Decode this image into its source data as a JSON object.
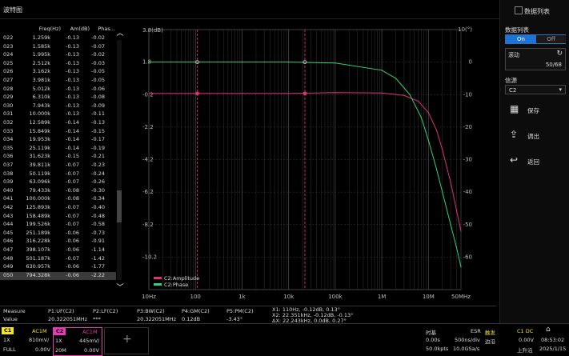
{
  "title": "波特图",
  "table": {
    "headers": {
      "freq": "Freq(Hz)",
      "amp": "Am(dB)",
      "phase": "Phas..."
    },
    "rows": [
      {
        "idx": "022",
        "freq": "1.259k",
        "amp": "-0.13",
        "phase": "-0.02"
      },
      {
        "idx": "023",
        "freq": "1.585k",
        "amp": "-0.13",
        "phase": "-0.07"
      },
      {
        "idx": "024",
        "freq": "1.995k",
        "amp": "-0.13",
        "phase": "-0.02"
      },
      {
        "idx": "025",
        "freq": "2.512k",
        "amp": "-0.13",
        "phase": "-0.03"
      },
      {
        "idx": "026",
        "freq": "3.162k",
        "amp": "-0.13",
        "phase": "-0.05"
      },
      {
        "idx": "027",
        "freq": "3.981k",
        "amp": "-0.13",
        "phase": "-0.05"
      },
      {
        "idx": "028",
        "freq": "5.012k",
        "amp": "-0.13",
        "phase": "-0.06"
      },
      {
        "idx": "029",
        "freq": "6.310k",
        "amp": "-0.13",
        "phase": "-0.08"
      },
      {
        "idx": "030",
        "freq": "7.943k",
        "amp": "-0.13",
        "phase": "-0.09"
      },
      {
        "idx": "031",
        "freq": "10.000k",
        "amp": "-0.13",
        "phase": "-0.11"
      },
      {
        "idx": "032",
        "freq": "12.589k",
        "amp": "-0.14",
        "phase": "-0.13"
      },
      {
        "idx": "033",
        "freq": "15.849k",
        "amp": "-0.14",
        "phase": "-0.15"
      },
      {
        "idx": "034",
        "freq": "19.953k",
        "amp": "-0.14",
        "phase": "-0.17"
      },
      {
        "idx": "035",
        "freq": "25.119k",
        "amp": "-0.14",
        "phase": "-0.19"
      },
      {
        "idx": "036",
        "freq": "31.623k",
        "amp": "-0.15",
        "phase": "-0.21"
      },
      {
        "idx": "037",
        "freq": "39.811k",
        "amp": "-0.07",
        "phase": "-0.23"
      },
      {
        "idx": "038",
        "freq": "50.119k",
        "amp": "-0.07",
        "phase": "-0.24"
      },
      {
        "idx": "039",
        "freq": "63.096k",
        "amp": "-0.07",
        "phase": "-0.26"
      },
      {
        "idx": "040",
        "freq": "79.433k",
        "amp": "-0.08",
        "phase": "-0.30"
      },
      {
        "idx": "041",
        "freq": "100.000k",
        "amp": "-0.08",
        "phase": "-0.34"
      },
      {
        "idx": "042",
        "freq": "125.893k",
        "amp": "-0.07",
        "phase": "-0.40"
      },
      {
        "idx": "043",
        "freq": "158.489k",
        "amp": "-0.07",
        "phase": "-0.48"
      },
      {
        "idx": "044",
        "freq": "199.526k",
        "amp": "-0.07",
        "phase": "-0.58"
      },
      {
        "idx": "045",
        "freq": "251.189k",
        "amp": "-0.06",
        "phase": "-0.73"
      },
      {
        "idx": "046",
        "freq": "316.228k",
        "amp": "-0.06",
        "phase": "-0.91"
      },
      {
        "idx": "047",
        "freq": "398.107k",
        "amp": "-0.06",
        "phase": "-1.14"
      },
      {
        "idx": "048",
        "freq": "501.187k",
        "amp": "-0.07",
        "phase": "-1.42"
      },
      {
        "idx": "049",
        "freq": "630.957k",
        "amp": "-0.06",
        "phase": "-1.77"
      },
      {
        "idx": "050",
        "freq": "794.328k",
        "amp": "-0.06",
        "phase": "-2.22"
      }
    ]
  },
  "chart_data": {
    "type": "line",
    "xscale": "log",
    "xlim": [
      10,
      50000000
    ],
    "x_ticks": [
      "10Hz",
      "100",
      "1k",
      "10k",
      "100k",
      "1M",
      "10M",
      "50MHz"
    ],
    "y_left_ticks": [
      "3.8(dB)",
      "1.8",
      "-0.2",
      "-2.2",
      "-4.2",
      "-6.2",
      "-8.2",
      "-10.2"
    ],
    "y_right_ticks": [
      "10(°)",
      "0",
      "-10",
      "-20",
      "-30",
      "-40",
      "-50",
      "-60"
    ],
    "ylim_left": [
      -12.2,
      3.8
    ],
    "ylim_right": [
      -70,
      10
    ],
    "series": [
      {
        "name": "C2:Amplitude",
        "color": "#e0307a",
        "x": [
          10,
          100,
          1000,
          10000,
          100000,
          1000000,
          3000000,
          6000000,
          10000000,
          15000000,
          20000000,
          30000000,
          40000000,
          50000000
        ],
        "y": [
          -0.13,
          -0.13,
          -0.13,
          -0.13,
          -0.08,
          -0.1,
          -0.25,
          -0.6,
          -1.3,
          -2.4,
          -3.6,
          -5.6,
          -7.3,
          -8.6
        ]
      },
      {
        "name": "C2:Phase",
        "color": "#2fd17a",
        "x": [
          10,
          100,
          1000,
          10000,
          100000,
          1000000,
          2000000,
          4000000,
          7000000,
          10000000,
          15000000,
          20000000,
          30000000,
          40000000,
          50000000
        ],
        "y": [
          0,
          0,
          0,
          0,
          -0.3,
          -2.5,
          -5,
          -10,
          -17,
          -24,
          -33,
          -40,
          -50,
          -57,
          -63
        ]
      }
    ],
    "markers": [
      {
        "x": 110,
        "label": "X1"
      },
      {
        "x": 22351,
        "label": "X2"
      }
    ]
  },
  "right_panel": {
    "header": "数据列表",
    "data_list_label": "数据列表",
    "on": "On",
    "off": "Off",
    "scroll_label": "滚动",
    "scroll_value": "50/68",
    "source_label": "信源",
    "source_value": "C2",
    "save": "保存",
    "export": "调出",
    "back": "返回"
  },
  "measure": {
    "label": "Measure",
    "value_label": "Value",
    "p1": "P1:UF(C2)",
    "p2": "P2:LF(C2)",
    "p3": "P3:BW(C2)",
    "p4": "P4:GM(C2)",
    "p5": "P5:PM(C2)",
    "p1_val": "20.322051MHz",
    "p2_val": "***",
    "p3_val": "20.322051MHz",
    "p4_val": "0.12dB",
    "p5_val": "-3.43°",
    "x1": "X1: 110Hz, -0.12dB, 0.13°",
    "x2": "X2: 22.351kHz, -0.12dB, -0.13°",
    "dx": "ΔX: 22.243kHz, 0.0dB, 0.27°"
  },
  "status": {
    "c1": {
      "tag": "C1",
      "coupling": "AC1M",
      "probe": "1X",
      "scale": "810mV/",
      "bw": "FULL",
      "offset": "0.00V",
      "color": "#f2e61c"
    },
    "c2": {
      "tag": "C2",
      "coupling": "AC1M",
      "probe": "1X",
      "scale": "445mV/",
      "bw": "20M",
      "offset": "0.00V",
      "color": "#e43bb0"
    },
    "timebase": {
      "label": "时基",
      "esr": "ESR",
      "offset": "0.00s",
      "scale": "500ns/div",
      "pts": "50.0kpts",
      "rate": "10.0GSa/s"
    },
    "trigger": {
      "label": "触发",
      "source": "C1 DC",
      "mode": "边沿",
      "level": "0.00V",
      "slope": "上升沿"
    },
    "time": "08:53:02",
    "date": "2025/1/15"
  }
}
